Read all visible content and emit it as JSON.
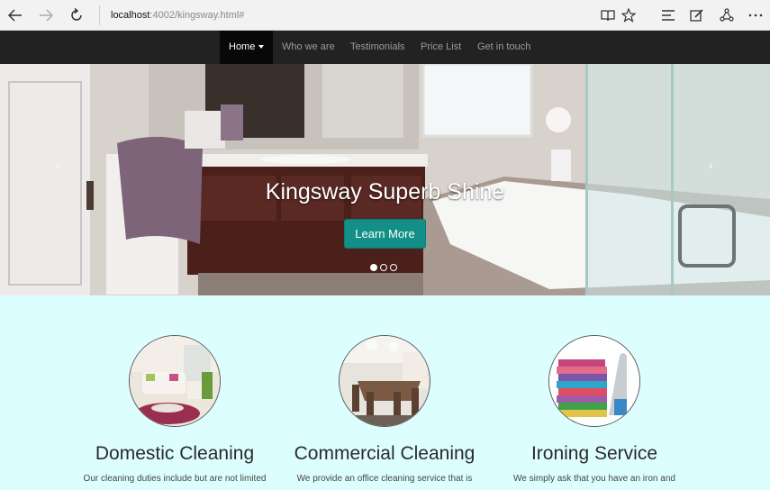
{
  "browser": {
    "url_host": "localhost",
    "url_path": ":4002/kingsway.html#"
  },
  "navbar": {
    "items": [
      {
        "label": "Home"
      },
      {
        "label": "Who we are"
      },
      {
        "label": "Testimonials"
      },
      {
        "label": "Price List"
      },
      {
        "label": "Get in touch"
      }
    ]
  },
  "carousel": {
    "title": "Kingsway Superb Shine",
    "button_label": "Learn More",
    "prev_glyph": "‹",
    "next_glyph": "›",
    "slide_count": 3,
    "active_slide": 1
  },
  "services": [
    {
      "title": "Domestic Cleaning",
      "text": "Our cleaning duties include but are not limited",
      "icon": "living-room-image"
    },
    {
      "title": "Commercial Cleaning",
      "text": "We provide an office cleaning service that is",
      "icon": "dining-room-image"
    },
    {
      "title": "Ironing Service",
      "text": "We simply ask that you have an iron and",
      "icon": "folded-clothes-image"
    }
  ],
  "colors": {
    "navbar_bg": "#222222",
    "page_bg": "#ddfefe",
    "accent_button": "#128f86"
  }
}
